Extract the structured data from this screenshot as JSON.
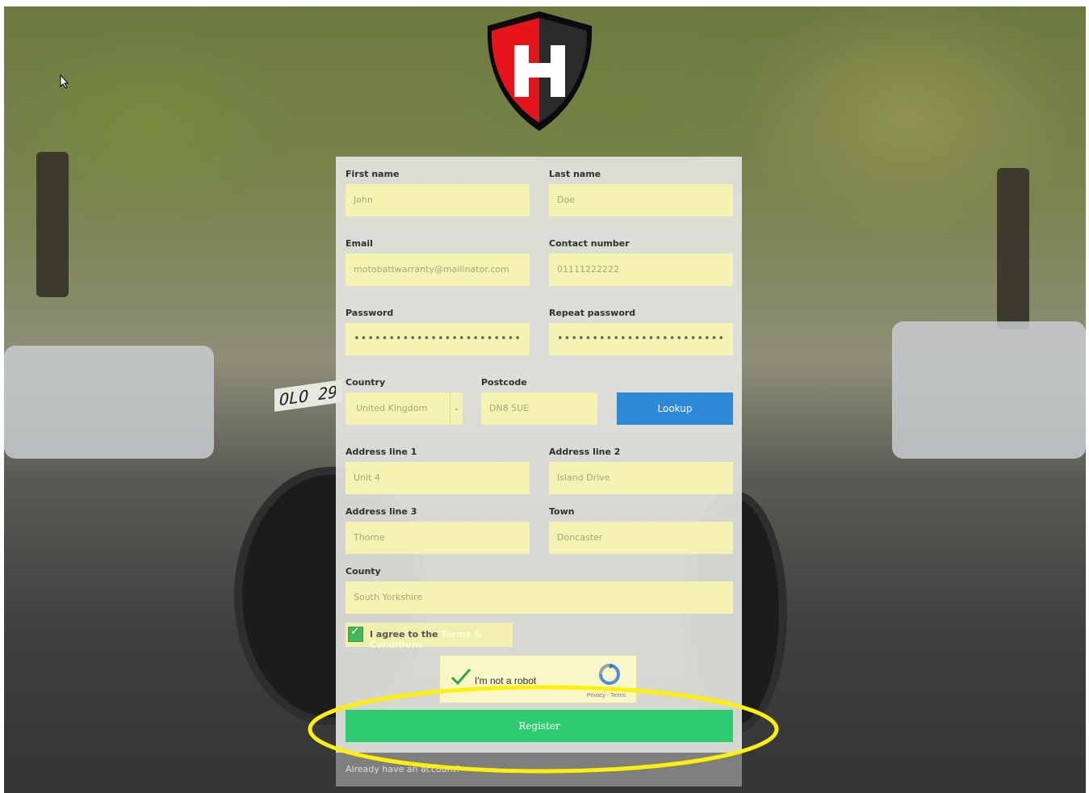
{
  "brand": {
    "logo_letter": "H",
    "logo_left_color": "#e8141c",
    "logo_right_color": "#2b2b2b"
  },
  "background": {
    "plate_text": "OLO 29"
  },
  "form": {
    "first_name": {
      "label": "First name",
      "placeholder": "John"
    },
    "last_name": {
      "label": "Last name",
      "placeholder": "Doe"
    },
    "email": {
      "label": "Email",
      "value": "motobattwarranty@mailinator.com"
    },
    "contact_number": {
      "label": "Contact number",
      "value": "01111222222"
    },
    "password": {
      "label": "Password",
      "value": "••••••••••••••••••••••••"
    },
    "repeat_password": {
      "label": "Repeat password",
      "value": "••••••••••••••••••••••••"
    },
    "country": {
      "label": "Country",
      "value": "United Kingdom"
    },
    "postcode": {
      "label": "Postcode",
      "value": "DN8 5UE"
    },
    "lookup_label": "Lookup",
    "address_line_1": {
      "label": "Address line 1",
      "value": "Unit 4"
    },
    "address_line_2": {
      "label": "Address line 2",
      "value": "Island Drive"
    },
    "address_line_3": {
      "label": "Address line 3",
      "value": "Thorne"
    },
    "town": {
      "label": "Town",
      "value": "Doncaster"
    },
    "county": {
      "label": "County",
      "value": "South Yorkshire"
    },
    "terms": {
      "prefix": "I agree to the ",
      "link": "Terms & Conditions",
      "checked": true
    },
    "captcha": {
      "label": "I'm not a robot",
      "footer": "Privacy - Terms",
      "partial": "recaptcha"
    },
    "register_label": "Register",
    "already_account": "Already have an account?"
  },
  "colors": {
    "field_bg": "#f4f3b4",
    "lookup": "#2d88d6",
    "register": "#2ecc71",
    "highlight": "#fff200"
  }
}
